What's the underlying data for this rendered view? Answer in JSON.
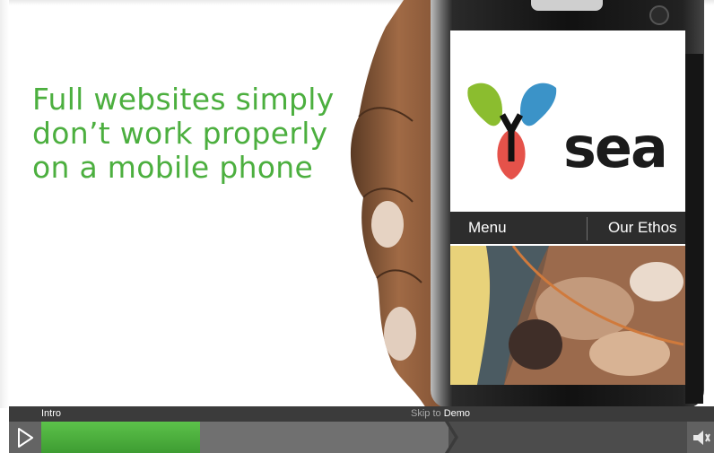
{
  "slide": {
    "headline_lines": [
      "Full websites simply",
      "don’t work properly",
      "on a mobile phone"
    ]
  },
  "phone_site": {
    "brand": "sea",
    "nav": [
      "Menu",
      "Our Ethos"
    ]
  },
  "player": {
    "intro_label": "Intro",
    "skip_prefix": "Skip to",
    "skip_target": "Demo",
    "progress": 0.38,
    "play_icon": "play-icon",
    "volume_icon": "volume-icon"
  },
  "colors": {
    "headline": "#4caf3f",
    "progress": "#4cb43c",
    "logo_green": "#8bbd2f",
    "logo_blue": "#3b93c8",
    "logo_red": "#e5524a"
  }
}
